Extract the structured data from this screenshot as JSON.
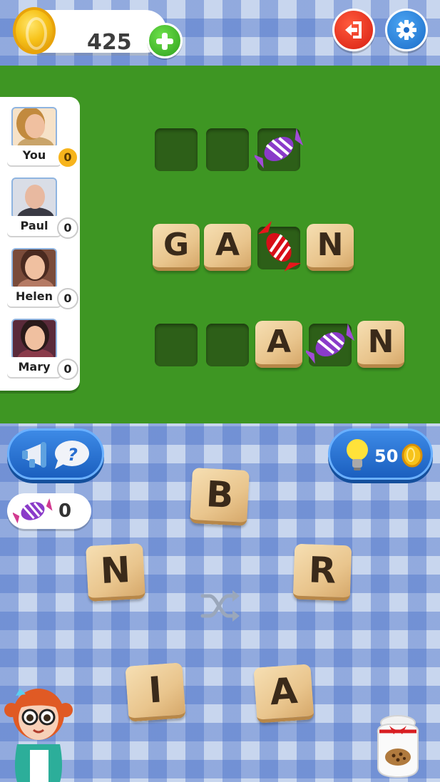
{
  "header": {
    "coins": "425",
    "add_coins_icon": "plus-icon",
    "exit_icon": "exit-door-icon",
    "settings_icon": "gear-icon"
  },
  "players": [
    {
      "name": "You",
      "score": "0",
      "highlight": true
    },
    {
      "name": "Paul",
      "score": "0",
      "highlight": false
    },
    {
      "name": "Helen",
      "score": "0",
      "highlight": false
    },
    {
      "name": "Mary",
      "score": "0",
      "highlight": false
    }
  ],
  "board": {
    "words": [
      {
        "cells": [
          "",
          "",
          "candy-purple"
        ]
      },
      {
        "cells": [
          "G",
          "A",
          "candy-red",
          "N"
        ]
      },
      {
        "cells": [
          "",
          "",
          "A",
          "candy-purple",
          "N"
        ]
      }
    ]
  },
  "controls": {
    "hint_icon": "megaphone-question-icon",
    "bulb_cost": "50",
    "candy_count": "0",
    "shuffle_icon": "shuffle-icon"
  },
  "letters": {
    "b": "B",
    "n": "N",
    "r": "R",
    "i": "I",
    "a": "A"
  },
  "colors": {
    "board_green": "#3e9623",
    "slot_green": "#2d5f18",
    "button_blue": "#1b5fbf",
    "exit_red": "#d71f12",
    "coin_gold": "#f7c31a"
  }
}
